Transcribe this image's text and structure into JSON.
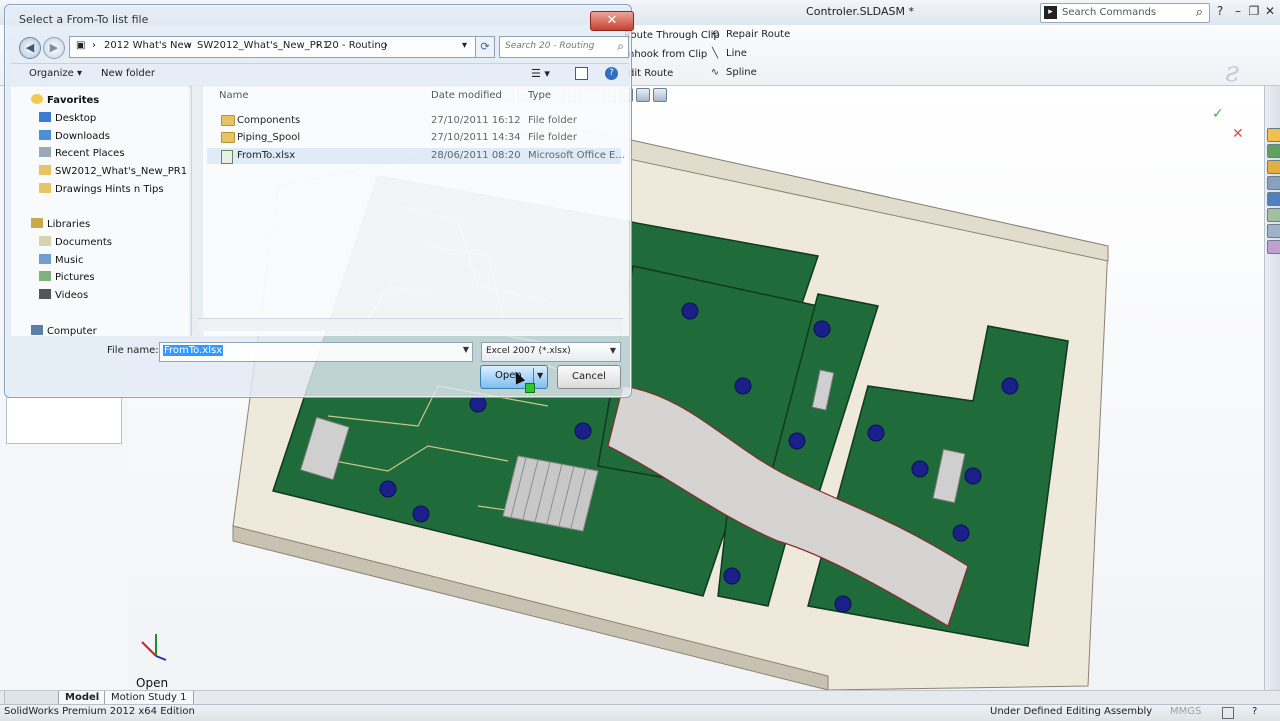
{
  "app": {
    "document_title": "Controler.SLDASM *",
    "search_commands_placeholder": "Search Commands",
    "status_edition": "SolidWorks Premium 2012 x64 Edition",
    "status_defined": "Under Defined",
    "status_mode": "Editing Assembly",
    "status_units": "MMGS"
  },
  "commandbar": {
    "route_through_clip": "Route Through Clip",
    "unhook_from_clip": "nhook from Clip",
    "edit_route": "dit Route",
    "repair_route": "Repair Route",
    "line": "Line",
    "spline": "Spline"
  },
  "tabs": [
    "Model",
    "Motion Study 1"
  ],
  "viewport_caption": "Open",
  "dialog": {
    "title": "Select a From-To list file",
    "breadcrumbs": [
      "2012 What's New",
      "SW2012_What's_New_PR1",
      "20 - Routing"
    ],
    "search_placeholder": "Search 20 - Routing",
    "toolbar": {
      "organize": "Organize",
      "new_folder": "New folder"
    },
    "nav": {
      "favorites_header": "Favorites",
      "favorites": [
        "Desktop",
        "Downloads",
        "Recent Places",
        "SW2012_What's_New_PR1",
        "Drawings Hints n Tips"
      ],
      "libraries_header": "Libraries",
      "libraries": [
        "Documents",
        "Music",
        "Pictures",
        "Videos"
      ],
      "computer": "Computer"
    },
    "columns": {
      "name": "Name",
      "date_modified": "Date modified",
      "type": "Type"
    },
    "files": [
      {
        "name": "Components",
        "date": "27/10/2011 16:12",
        "type": "File folder",
        "kind": "folder"
      },
      {
        "name": "Piping_Spool",
        "date": "27/10/2011 14:34",
        "type": "File folder",
        "kind": "folder"
      },
      {
        "name": "FromTo.xlsx",
        "date": "28/06/2011 08:20",
        "type": "Microsoft Office E...",
        "kind": "xlsx"
      }
    ],
    "file_name_label": "File name:",
    "file_name_value": "FromTo.xlsx",
    "file_type_value": "Excel 2007 (*.xlsx)",
    "open_label": "Open",
    "cancel_label": "Cancel"
  },
  "colors": {
    "pcb_green": "#1f6b3a",
    "pcb_trace": "#c9c78a",
    "capacitor": "#1a1f8a",
    "tray": "#efe9dc",
    "cable": "#d6d4d2",
    "selection": "#3399ff"
  }
}
